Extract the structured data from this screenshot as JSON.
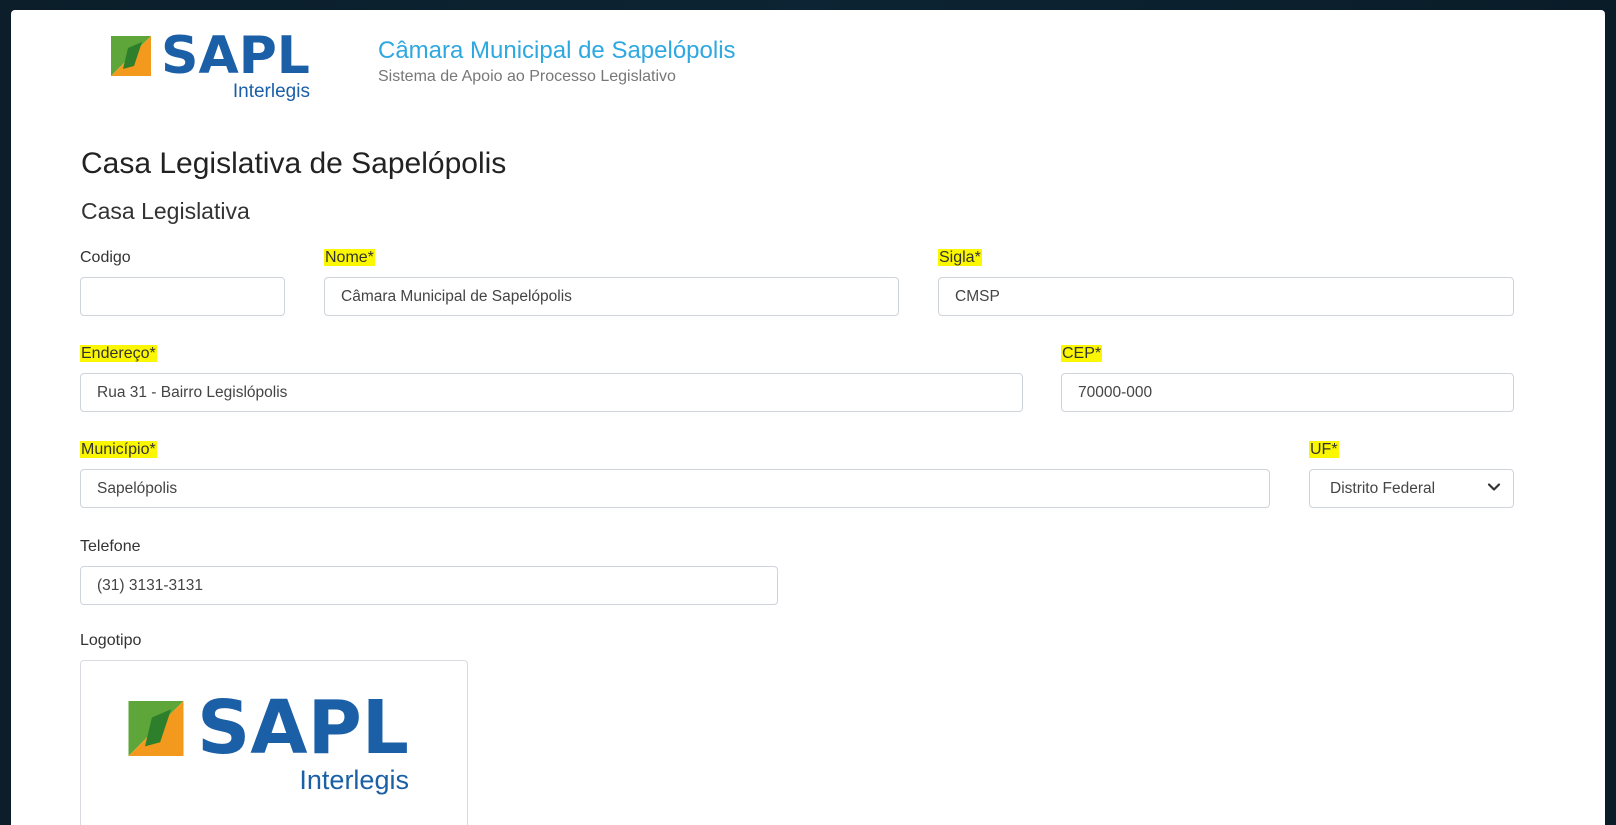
{
  "header": {
    "logo_word": "SAPL",
    "logo_sub": "Interlegis",
    "title": "Câmara Municipal de Sapelópolis",
    "subtitle": "Sistema de Apoio ao Processo Legislativo"
  },
  "page_title": "Casa Legislativa de Sapelópolis",
  "section_title": "Casa Legislativa",
  "fields": {
    "codigo": {
      "label": "Codigo",
      "value": ""
    },
    "nome": {
      "label": "Nome*",
      "value": "Câmara Municipal de Sapelópolis"
    },
    "sigla": {
      "label": "Sigla*",
      "value": "CMSP"
    },
    "endereco": {
      "label": "Endereço*",
      "value": "Rua 31 - Bairro Legislópolis"
    },
    "cep": {
      "label": "CEP*",
      "value": "70000-000"
    },
    "municipio": {
      "label": "Município*",
      "value": "Sapelópolis"
    },
    "uf": {
      "label": "UF*",
      "value": "Distrito Federal"
    },
    "telefone": {
      "label": "Telefone",
      "value": "(31) 3131-3131"
    },
    "logotipo": {
      "label": "Logotipo"
    }
  },
  "logotipo_preview": {
    "word": "SAPL",
    "sub": "Interlegis"
  },
  "colors": {
    "brand_blue": "#1b5fa6",
    "brand_green": "#5ea63a",
    "brand_orange": "#f39a1e",
    "title_blue": "#2ea8e0",
    "highlight": "#fbf700"
  }
}
